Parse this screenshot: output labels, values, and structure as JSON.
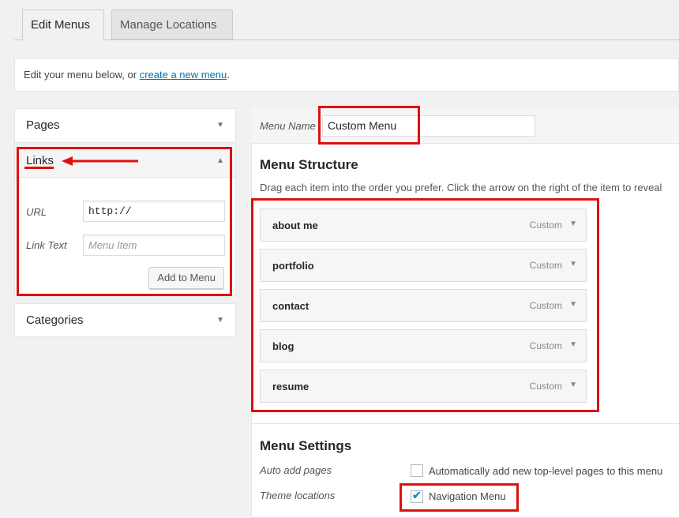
{
  "tabs": {
    "edit_menus": "Edit Menus",
    "manage_locations": "Manage Locations"
  },
  "notice": {
    "prefix": "Edit your menu below, or ",
    "link": "create a new menu",
    "suffix": "."
  },
  "left": {
    "pages": "Pages",
    "links": {
      "title": "Links",
      "url_label": "URL",
      "url_value": "http://",
      "link_text_label": "Link Text",
      "link_text_placeholder": "Menu Item",
      "add_button": "Add to Menu"
    },
    "categories": "Categories"
  },
  "menu": {
    "name_label": "Menu Name",
    "name_value": "Custom Menu",
    "structure_title": "Menu Structure",
    "structure_desc": "Drag each item into the order you prefer. Click the arrow on the right of the item to reveal",
    "items": [
      {
        "title": "about me",
        "type": "Custom"
      },
      {
        "title": "portfolio",
        "type": "Custom"
      },
      {
        "title": "contact",
        "type": "Custom"
      },
      {
        "title": "blog",
        "type": "Custom"
      },
      {
        "title": "resume",
        "type": "Custom"
      }
    ]
  },
  "settings": {
    "title": "Menu Settings",
    "auto_add_label": "Auto add pages",
    "auto_add_text": "Automatically add new top-level pages to this menu",
    "auto_add_checked": false,
    "theme_locations_label": "Theme locations",
    "navigation_menu_text": "Navigation Menu",
    "navigation_menu_checked": true
  },
  "colors": {
    "annotation": "#e01010",
    "link": "#0073aa"
  }
}
